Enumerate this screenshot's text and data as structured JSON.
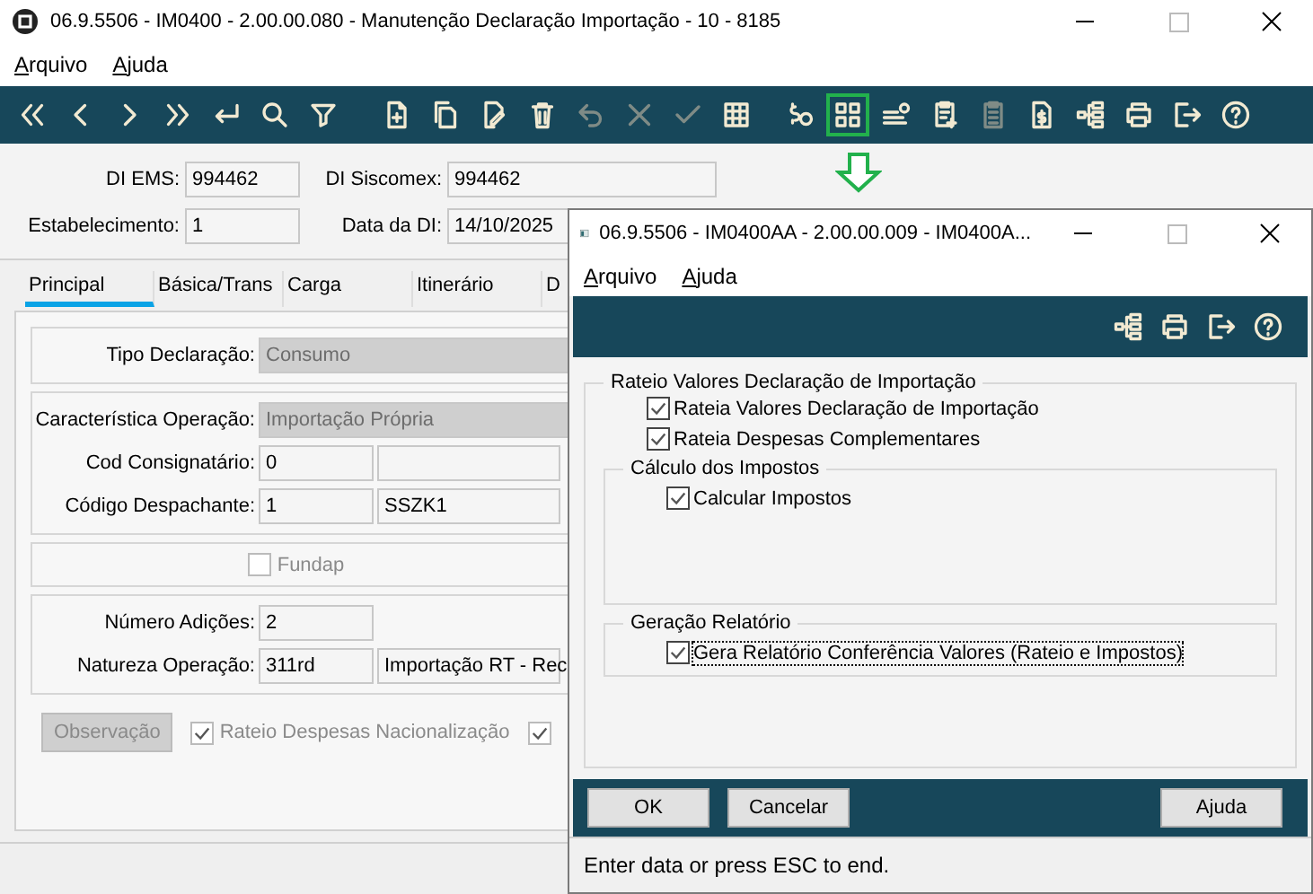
{
  "window": {
    "title": "06.9.5506 - IM0400 - 2.00.00.080 - Manutenção Declaração Importação - 10 - 8185"
  },
  "menu": [
    "Arquivo",
    "Ajuda"
  ],
  "toolbar": [
    {
      "disabled": false,
      "selected": false
    },
    {
      "disabled": false,
      "selected": false
    },
    {
      "disabled": false,
      "selected": false
    },
    {
      "disabled": false,
      "selected": false
    },
    {
      "disabled": false,
      "selected": false
    },
    {
      "disabled": false,
      "selected": false
    },
    {
      "disabled": false,
      "selected": false
    },
    {
      "disabled": false,
      "selected": false
    },
    {
      "disabled": false,
      "selected": false
    },
    {
      "disabled": false,
      "selected": false
    },
    {
      "disabled": false,
      "selected": false
    },
    {
      "disabled": true,
      "selected": false
    },
    {
      "disabled": true,
      "selected": false
    },
    {
      "disabled": true,
      "selected": false
    },
    {
      "disabled": false,
      "selected": false
    },
    {
      "disabled": false,
      "selected": false
    },
    {
      "disabled": false,
      "selected": true
    },
    {
      "disabled": false,
      "selected": false
    },
    {
      "disabled": false,
      "selected": false
    },
    {
      "disabled": true,
      "selected": false
    },
    {
      "disabled": false,
      "selected": false
    },
    {
      "disabled": false,
      "selected": false
    },
    {
      "disabled": false,
      "selected": false
    },
    {
      "disabled": false,
      "selected": false
    },
    {
      "disabled": false,
      "selected": false
    }
  ],
  "header": [
    {
      "label": "DI EMS:",
      "value": "994462"
    },
    {
      "label": "DI Siscomex:",
      "value": "994462"
    },
    {
      "label": "Estabelecimento:",
      "value": "1"
    },
    {
      "label": "Data da DI:",
      "value": "14/10/2025"
    }
  ],
  "tabs": [
    {
      "label": "Principal",
      "selected": true
    },
    {
      "label": "Básica/Trans",
      "selected": false
    },
    {
      "label": "Carga",
      "selected": false
    },
    {
      "label": "Itinerário",
      "selected": false
    },
    {
      "label": "D",
      "selected": false
    }
  ],
  "groups": [
    {
      "rows": [
        {
          "kind": "wide",
          "label": "Tipo Declaração:",
          "values": [
            "Consumo"
          ],
          "disabled": true
        }
      ]
    },
    {
      "rows": [
        {
          "kind": "wide",
          "label": "Característica Operação:",
          "values": [
            "Importação Própria"
          ],
          "disabled": true
        },
        {
          "kind": "pair",
          "label": "Cod Consignatário:",
          "values": [
            "0"
          ],
          "disabled": false
        },
        {
          "kind": "pair",
          "label": "Código Despachante:",
          "values": [
            "1",
            "SSZK1"
          ],
          "disabled": false
        }
      ]
    },
    {
      "checkbox": {
        "label": "Fundap",
        "checked": false,
        "disabled": true
      }
    },
    {
      "rows": [
        {
          "kind": "short",
          "label": "Número Adições:",
          "values": [
            "2"
          ],
          "disabled": false
        },
        {
          "kind": "pair",
          "label": "Natureza Operação:",
          "values": [
            "311rd",
            "Importação RT - Rec"
          ],
          "disabled": false
        }
      ]
    }
  ],
  "observacao_button": {
    "label": "Observação",
    "disabled": true
  },
  "bottom_checks": [
    {
      "label": "Rateio Despesas Nacionalização",
      "checked": true,
      "disabled": true
    },
    {
      "checked": true,
      "disabled": true
    }
  ],
  "dialog": {
    "title": "06.9.5506 - IM0400AA - 2.00.00.009 - IM0400A...",
    "menu": [
      "Arquivo",
      "Ajuda"
    ],
    "group": {
      "title": "Rateio Valores Declaração de Importação",
      "checkboxes": [
        {
          "label": "Rateia Valores Declaração de Importação",
          "checked": true,
          "focused": false
        },
        {
          "label": "Rateia Despesas Complementares",
          "checked": true,
          "focused": false
        }
      ],
      "subgroups": [
        {
          "title": "Cálculo dos Impostos",
          "checkboxes": [
            {
              "label": "Calcular Impostos",
              "checked": true,
              "focused": false
            }
          ]
        },
        {
          "title": "Geração Relatório",
          "checkboxes": [
            {
              "label": "Gera Relatório Conferência Valores (Rateio e Impostos)",
              "checked": true,
              "focused": true
            }
          ]
        }
      ]
    },
    "buttons": [
      "OK",
      "Cancelar",
      "Ajuda"
    ],
    "status": "Enter data or press ESC to end."
  }
}
